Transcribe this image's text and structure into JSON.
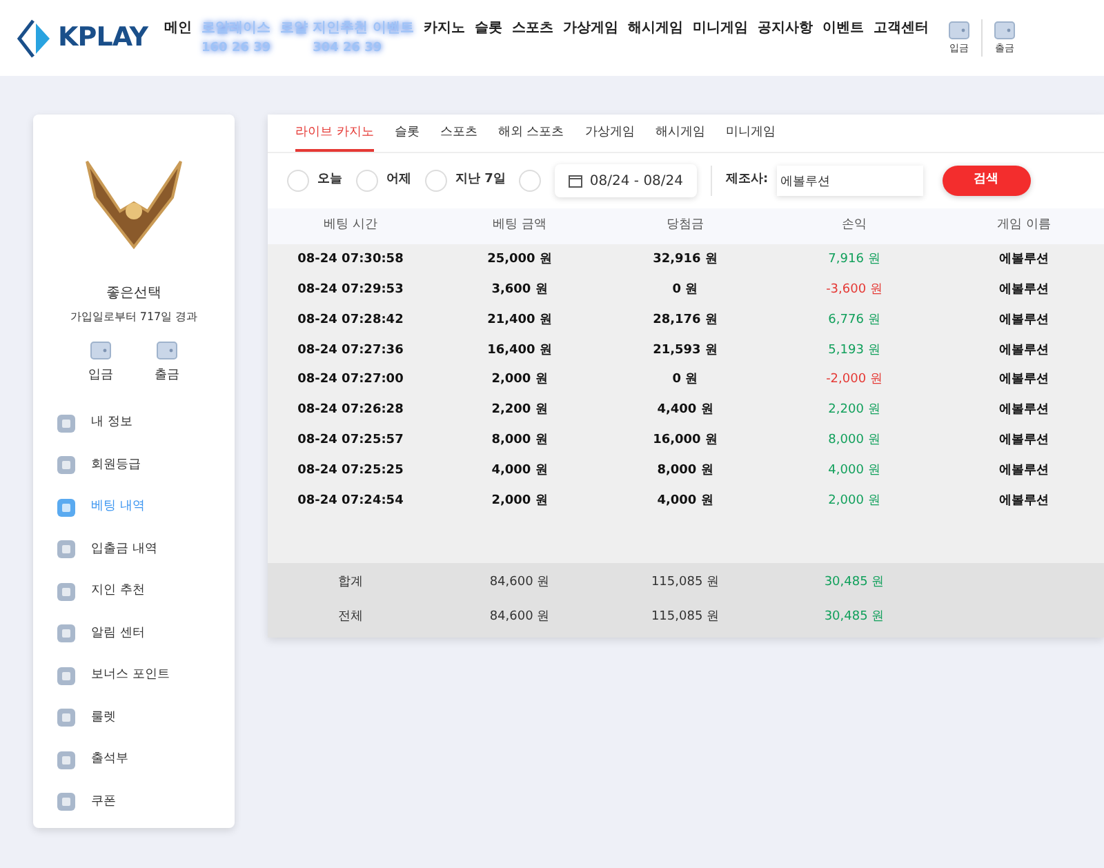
{
  "logo": {
    "text": "KPLAY"
  },
  "nav": [
    {
      "label": "메인",
      "kind": "plain"
    },
    {
      "label": "로얄레이스",
      "sub": "160 26 39",
      "kind": "promo"
    },
    {
      "label": "로얄 지인추천 이벤트",
      "sub": "304 26 39",
      "kind": "promo"
    },
    {
      "label": "카지노",
      "kind": "plain"
    },
    {
      "label": "슬롯",
      "kind": "plain"
    },
    {
      "label": "스포츠",
      "kind": "plain"
    },
    {
      "label": "가상게임",
      "kind": "plain"
    },
    {
      "label": "해시게임",
      "kind": "plain"
    },
    {
      "label": "미니게임",
      "kind": "plain"
    },
    {
      "label": "공지사항",
      "kind": "plain"
    },
    {
      "label": "이벤트",
      "kind": "plain"
    },
    {
      "label": "고객센터",
      "kind": "plain"
    }
  ],
  "header_actions": [
    "입금",
    "출금"
  ],
  "profile": {
    "name": "좋은선택",
    "since": "가입일로부터 717일 경과",
    "actions": [
      "입금",
      "출금"
    ]
  },
  "menu": [
    {
      "label": "내 정보",
      "selected": false
    },
    {
      "label": "회원등급",
      "selected": false
    },
    {
      "label": "베팅 내역",
      "selected": true
    },
    {
      "label": "입출금 내역",
      "selected": false
    },
    {
      "label": "지인 추천",
      "selected": false
    },
    {
      "label": "알림 센터",
      "selected": false
    },
    {
      "label": "보너스 포인트",
      "selected": false
    },
    {
      "label": "룰렛",
      "selected": false
    },
    {
      "label": "출석부",
      "selected": false
    },
    {
      "label": "쿠폰",
      "selected": false
    }
  ],
  "tabs": [
    {
      "label": "라이브 카지노",
      "selected": true
    },
    {
      "label": "슬롯",
      "selected": false
    },
    {
      "label": "스포츠",
      "selected": false
    },
    {
      "label": "해외 스포츠",
      "selected": false
    },
    {
      "label": "가상게임",
      "selected": false
    },
    {
      "label": "해시게임",
      "selected": false
    },
    {
      "label": "미니게임",
      "selected": false
    }
  ],
  "filters": {
    "periods": [
      {
        "label": "오늘",
        "selected": false
      },
      {
        "label": "어제",
        "selected": false
      },
      {
        "label": "지난 7일",
        "selected": false
      },
      {
        "selected": false
      }
    ],
    "date_range": "08/24 - 08/24",
    "provider_label": "제조사:",
    "provider_value": "에볼루션",
    "search_button": "검색"
  },
  "table": {
    "columns": [
      "베팅 시간",
      "베팅 금액",
      "당첨금",
      "손익",
      "게임 이름"
    ],
    "rows": [
      {
        "time": "08-24 07:30:58",
        "bet": "25,000 원",
        "win": "32,916 원",
        "profit": "7,916 원",
        "color": "#12a05c",
        "game": "에볼루션"
      },
      {
        "time": "08-24 07:29:53",
        "bet": "3,600 원",
        "win": "0 원",
        "profit": "-3,600 원",
        "color": "#e53935",
        "game": "에볼루션"
      },
      {
        "time": "08-24 07:28:42",
        "bet": "21,400 원",
        "win": "28,176 원",
        "profit": "6,776 원",
        "color": "#12a05c",
        "game": "에볼루션"
      },
      {
        "time": "08-24 07:27:36",
        "bet": "16,400 원",
        "win": "21,593 원",
        "profit": "5,193 원",
        "color": "#12a05c",
        "game": "에볼루션"
      },
      {
        "time": "08-24 07:27:00",
        "bet": "2,000 원",
        "win": "0 원",
        "profit": "-2,000 원",
        "color": "#e53935",
        "game": "에볼루션"
      },
      {
        "time": "08-24 07:26:28",
        "bet": "2,200 원",
        "win": "4,400 원",
        "profit": "2,200 원",
        "color": "#12a05c",
        "game": "에볼루션"
      },
      {
        "time": "08-24 07:25:57",
        "bet": "8,000 원",
        "win": "16,000 원",
        "profit": "8,000 원",
        "color": "#12a05c",
        "game": "에볼루션"
      },
      {
        "time": "08-24 07:25:25",
        "bet": "4,000 원",
        "win": "8,000 원",
        "profit": "4,000 원",
        "color": "#12a05c",
        "game": "에볼루션"
      },
      {
        "time": "08-24 07:24:54",
        "bet": "2,000 원",
        "win": "4,000 원",
        "profit": "2,000 원",
        "color": "#12a05c",
        "game": "에볼루션"
      }
    ],
    "totals": [
      {
        "label": "합계",
        "bet": "84,600 원",
        "win": "115,085 원",
        "profit": "30,485 원",
        "color": "#12a05c"
      },
      {
        "label": "전체",
        "bet": "84,600 원",
        "win": "115,085 원",
        "profit": "30,485 원",
        "color": "#12a05c"
      }
    ]
  }
}
